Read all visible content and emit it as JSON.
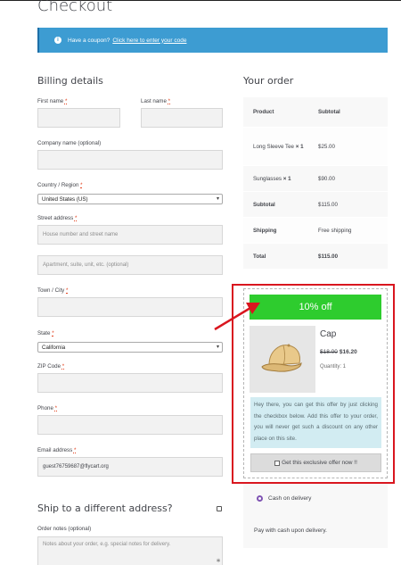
{
  "page": {
    "title": "Checkout"
  },
  "notice": {
    "text": "Have a coupon?",
    "link": "Click here to enter your code"
  },
  "billing": {
    "heading": "Billing details",
    "first_name_label": "First name",
    "last_name_label": "Last name",
    "company_label": "Company name (optional)",
    "country_label": "Country / Region",
    "country_value": "United States (US)",
    "street_label": "Street address",
    "street_placeholder": "House number and street name",
    "street2_placeholder": "Apartment, suite, unit, etc. (optional)",
    "town_label": "Town / City",
    "state_label": "State",
    "state_value": "California",
    "zip_label": "ZIP Code",
    "phone_label": "Phone",
    "email_label": "Email address",
    "email_value": "guest76759687@flycart.org",
    "required_mark": "*"
  },
  "shipping": {
    "heading": "Ship to a different address?",
    "notes_label": "Order notes (optional)",
    "notes_placeholder": "Notes about your order, e.g. special notes for delivery."
  },
  "order": {
    "heading": "Your order",
    "col_product": "Product",
    "col_subtotal": "Subtotal",
    "items": [
      {
        "name": "Long Sleeve Tee",
        "qty": "× 1",
        "price": "$25.00"
      },
      {
        "name": "Sunglasses",
        "qty": "× 1",
        "price": "$90.00"
      }
    ],
    "subtotal_label": "Subtotal",
    "subtotal_value": "$115.00",
    "shipping_label": "Shipping",
    "shipping_value": "Free shipping",
    "total_label": "Total",
    "total_value": "$115.00"
  },
  "offer": {
    "banner": "10% off",
    "product_name": "Cap",
    "old_price": "$18.00",
    "new_price": "$16.20",
    "quantity": "Quantity: 1",
    "description": "Hey there, you can get this offer by just clicking the checkbox below. Add this offer to your order, you will never get such a discount on any other place on this site.",
    "cta": "Get this exclusive offer now !!",
    "banner_color": "#2ecc2e",
    "highlight_color": "#d9161f"
  },
  "payment": {
    "method": "Cash on delivery",
    "description": "Pay with cash upon delivery.",
    "accent_color": "#7f54b3"
  }
}
